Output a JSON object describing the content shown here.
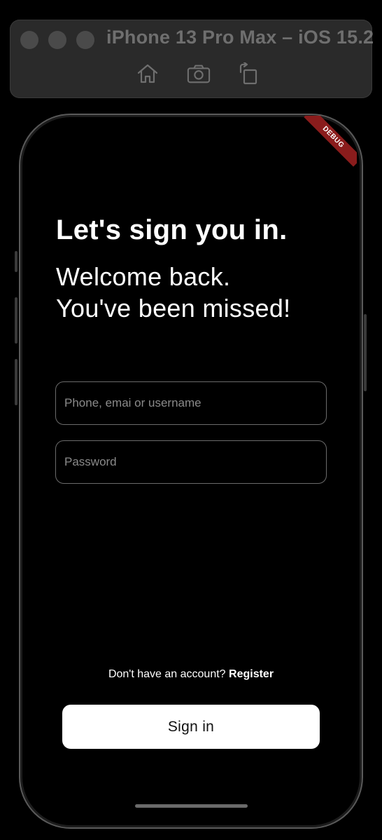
{
  "simulator": {
    "title": "iPhone 13 Pro Max – iOS 15.2",
    "tools": [
      {
        "name": "home-icon"
      },
      {
        "name": "camera-icon"
      },
      {
        "name": "rotate-icon"
      }
    ]
  },
  "debug_badge": "DEBUG",
  "signin": {
    "heading": "Let's sign you in.",
    "subtitle_line1": "Welcome back.",
    "subtitle_line2": "You've been missed!",
    "username_placeholder": "Phone, emai or username",
    "password_placeholder": "Password",
    "register_prompt": "Don't have an account? ",
    "register_link": "Register",
    "submit_label": "Sign in"
  },
  "colors": {
    "background": "#000000",
    "toolbar": "#2a2a2a",
    "button_bg": "#ffffff",
    "debug_ribbon": "#8a1c1c",
    "field_border": "#6b6b6b"
  }
}
